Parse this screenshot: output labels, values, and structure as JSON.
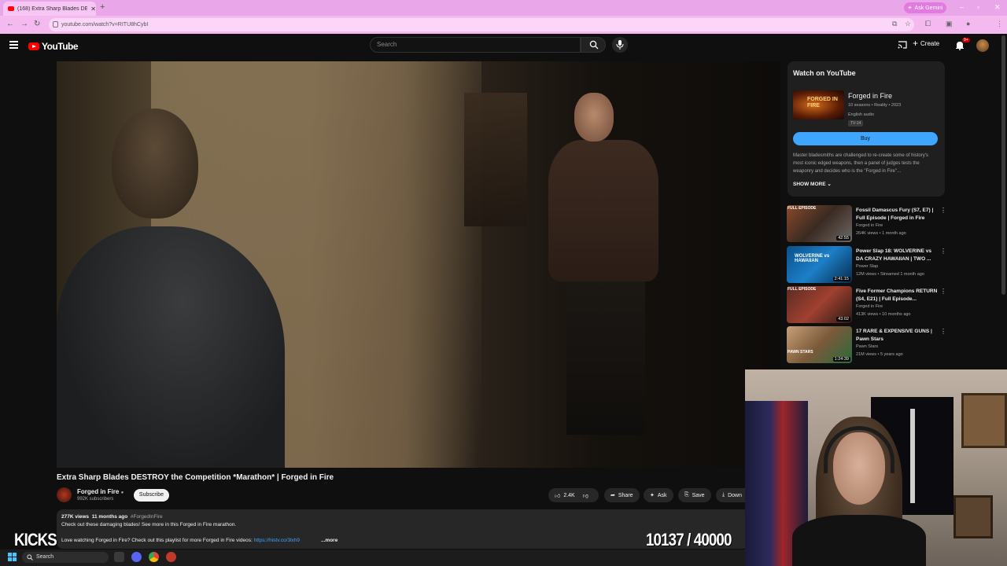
{
  "browser": {
    "tab_title": "(168) Extra Sharp Blades DE",
    "new_tab": "+",
    "ask_gemini": "Ask Gemini",
    "url": "youtube.com/watch?v=RITU8hCybI"
  },
  "header": {
    "logo": "YouTube",
    "search_placeholder": "Search",
    "create_label": "Create",
    "notif_count": "9+"
  },
  "video": {
    "title": "Extra Sharp Blades DESTROY the Competition *Marathon* | Forged in Fire",
    "channel": "Forged in Fire",
    "subscribers": "992K subscribers",
    "subscribe_label": "Subscribe",
    "likes": "2.4K",
    "share_label": "Share",
    "ask_label": "Ask",
    "save_label": "Save",
    "download_label": "Down",
    "views": "277K views",
    "age": "11 months ago",
    "hashtag": "#ForgedInFire",
    "desc_line1": "Check out these damaging blades! See more in this Forged in Fire marathon.",
    "desc_line2": "Love watching Forged in Fire? Check out this playlist for more Forged in Fire videos:",
    "desc_link": "https://histv.co/3lxh9",
    "more_label": "...more"
  },
  "watch_panel": {
    "heading": "Watch on YouTube",
    "thumb_text": "FORGED IN FIRE",
    "show_name": "Forged in Fire",
    "info": "10 seasons • Reality • 2023",
    "audio": "English audio",
    "rating": "TV-14",
    "buy_label": "Buy",
    "description": "Master bladesmiths are challenged to re-create some of history's most iconic edged weapons, then a panel of judges tests the weaponry and decides who is the \"Forged in Fire\"...",
    "show_more": "SHOW MORE"
  },
  "recommendations": [
    {
      "title": "Fossil Damascus Fury (S7, E7) | Full Episode | Forged in Fire",
      "channel": "Forged in Fire",
      "views": "264K views • 1 month ago",
      "duration": "42:55",
      "label": "FULL EPISODE"
    },
    {
      "title": "Power Slap 18: WOLVERINE vs DA CRAZY HAWAIIAN | TWO ...",
      "channel": "Power Slap",
      "views": "12M views • Streamed 1 month ago",
      "duration": "2:41:15",
      "label": "WOLVERINE vs HAWAIIAN"
    },
    {
      "title": "Five Former Champions RETURN (S4, E21) | Full Episode...",
      "channel": "Forged in Fire",
      "views": "413K views • 10 months ago",
      "duration": "43:02",
      "label": "FULL EPISODE"
    },
    {
      "title": "17 RARE & EXPENSIVE GUNS | Pawn Stars",
      "channel": "Pawn Stars",
      "views": "21M views • 5 years ago",
      "duration": "1:24:39",
      "label": "PAWN STARS"
    }
  ],
  "overlay": {
    "kicks": "KICKS",
    "counter": "10137 / 40000"
  },
  "taskbar": {
    "search_label": "Search"
  }
}
